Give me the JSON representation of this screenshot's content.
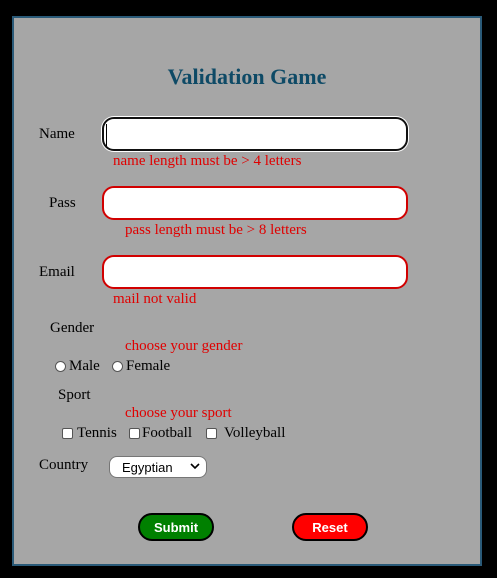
{
  "title": "Validation Game",
  "name": {
    "label": "Name",
    "value": "",
    "error": "name length must be > 4 letters"
  },
  "pass": {
    "label": "Pass",
    "value": "",
    "error": "pass length must be > 8 letters"
  },
  "email": {
    "label": "Email",
    "value": "",
    "error": "mail not valid"
  },
  "gender": {
    "label": "Gender",
    "error": "choose your gender",
    "options": [
      "Male",
      "Female"
    ]
  },
  "sport": {
    "label": "Sport",
    "error": "choose your sport",
    "options": [
      "Tennis",
      "Football",
      "Volleyball"
    ]
  },
  "country": {
    "label": "Country",
    "selected": "Egyptian"
  },
  "buttons": {
    "submit": "Submit",
    "reset": "Reset"
  },
  "colors": {
    "panel": "#a6a6a6",
    "title": "#0e4a66",
    "error": "#e00000",
    "submit": "#008000",
    "reset": "#ff0000"
  }
}
